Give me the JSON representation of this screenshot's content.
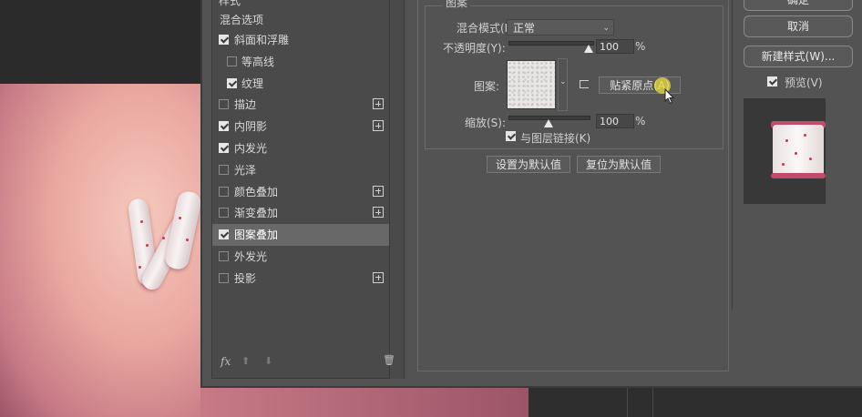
{
  "left_panel": {
    "header_partial": "样式",
    "blend_options": "混合选项",
    "items": [
      {
        "label": "斜面和浮雕",
        "checked": true,
        "has_plus": false,
        "indent": 0
      },
      {
        "label": "等高线",
        "checked": false,
        "has_plus": false,
        "indent": 1
      },
      {
        "label": "纹理",
        "checked": true,
        "has_plus": false,
        "indent": 1
      },
      {
        "label": "描边",
        "checked": false,
        "has_plus": true,
        "indent": 0
      },
      {
        "label": "内阴影",
        "checked": true,
        "has_plus": true,
        "indent": 0
      },
      {
        "label": "内发光",
        "checked": true,
        "has_plus": false,
        "indent": 0
      },
      {
        "label": "光泽",
        "checked": false,
        "has_plus": false,
        "indent": 0
      },
      {
        "label": "颜色叠加",
        "checked": false,
        "has_plus": true,
        "indent": 0
      },
      {
        "label": "渐变叠加",
        "checked": false,
        "has_plus": true,
        "indent": 0
      },
      {
        "label": "图案叠加",
        "checked": true,
        "has_plus": false,
        "indent": 0,
        "selected": true
      },
      {
        "label": "外发光",
        "checked": false,
        "has_plus": false,
        "indent": 0
      },
      {
        "label": "投影",
        "checked": false,
        "has_plus": true,
        "indent": 0
      }
    ],
    "toolbar": {
      "fx": "fx",
      "up": "⬆",
      "down": "⬇",
      "trash": "🗑"
    }
  },
  "pattern_panel": {
    "group_title": "图案",
    "blend_mode_label": "混合模式(B):",
    "blend_mode_value": "正常",
    "opacity_label": "不透明度(Y):",
    "opacity_value": "100",
    "opacity_fraction": 1.0,
    "percent": "%",
    "pattern_label": "图案:",
    "snap_button": "贴紧原点(A)",
    "scale_label": "缩放(S):",
    "scale_value": "100",
    "link_label": "与图层链接(K)",
    "link_checked": true,
    "set_default": "设置为默认值",
    "reset_default": "复位为默认值"
  },
  "right_panel": {
    "ok_partial": "确定",
    "cancel": "取消",
    "new_style": "新建样式(W)...",
    "preview_label": "预览(V)",
    "preview_checked": true
  },
  "colors": {
    "dialog_bg": "#535353",
    "selected_row": "#686868",
    "canvas_pink": "#e9a79f",
    "accent_red": "#c24a6a"
  }
}
